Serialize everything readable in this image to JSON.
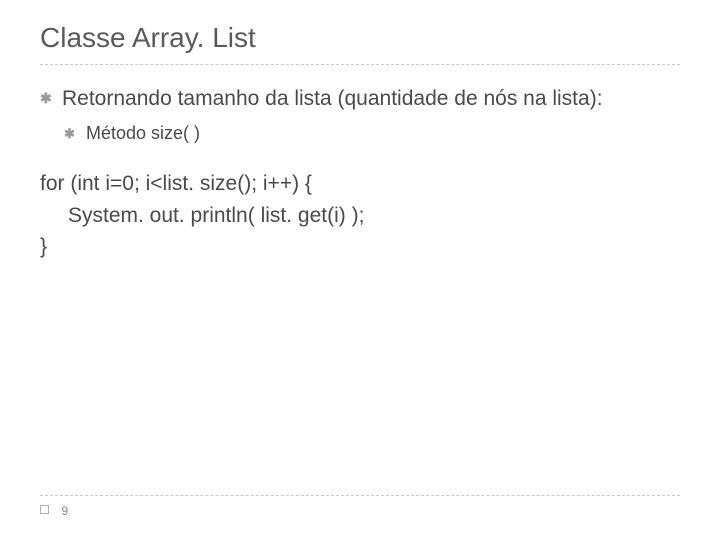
{
  "title": "Classe Array. List",
  "bullet": {
    "main": "Retornando tamanho da lista (quantidade de nós na lista):",
    "sub": "Método size( )"
  },
  "code": {
    "line1": "for (int i=0; i<list. size(); i++) {",
    "line2": "System. out. println( list. get(i) );",
    "line3": "}"
  },
  "pageNumber": "9",
  "icons": {
    "bullet": "✱",
    "subBullet": "✱"
  }
}
